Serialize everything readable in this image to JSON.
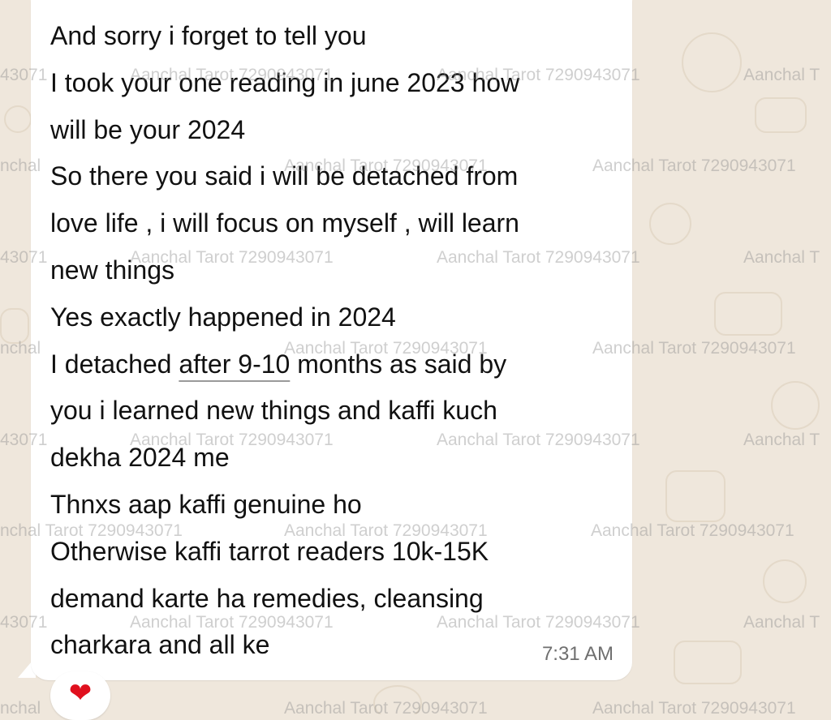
{
  "message": {
    "lines": [
      {
        "text": "And sorry i forget to tell you"
      },
      {
        "text": "I took your one reading in june 2023 how"
      },
      {
        "text": "will be your 2024"
      },
      {
        "text": "So there you said i will be detached from"
      },
      {
        "text": "love life , i will focus on myself , will learn"
      },
      {
        "text": "new things"
      },
      {
        "text": "Yes exactly happened in 2024"
      },
      {
        "pre": "I detached ",
        "underlined": "after 9-10",
        "post": " months as said by"
      },
      {
        "text": "you i learned new things and kaffi kuch"
      },
      {
        "text": "dekha 2024 me"
      },
      {
        "text": "Thnxs aap kaffi genuine ho"
      },
      {
        "text": "Otherwise kaffi tarrot readers 10k-15K"
      },
      {
        "text": "demand karte ha remedies, cleansing"
      },
      {
        "text": "charkara and all ke"
      }
    ],
    "time": "7:31 AM"
  },
  "reaction": {
    "emoji": "❤",
    "icon": "heart-icon"
  },
  "watermarks": {
    "full": "Aanchal Tarot 7290943071",
    "tail_partial": "943071",
    "head_partial": "Aanchal T",
    "mid_partial": "nchal Tarot 7290943071",
    "short_partial": "43071",
    "edge_partial": "nchal"
  },
  "colors": {
    "background": "#efe7dc",
    "bubble": "#ffffff",
    "text": "#111111",
    "time": "#6f6f6f",
    "heart": "#e0101e"
  }
}
